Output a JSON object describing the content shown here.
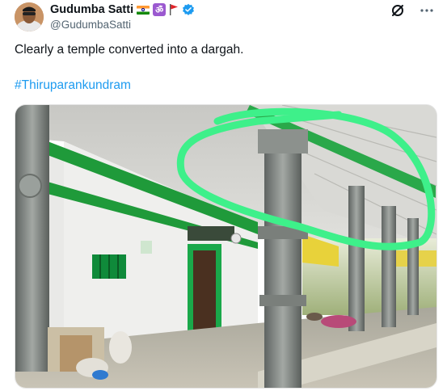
{
  "author": {
    "display_name": "Gudumba Satti",
    "handle": "@GudumbaSatti",
    "badges": [
      "india-flag-emoji",
      "om-symbol-emoji",
      "red-pennant-flag-emoji",
      "verified-badge"
    ]
  },
  "header_actions": {
    "grok_icon": "grok-icon",
    "more_icon": "more-options-icon"
  },
  "tweet": {
    "text": "Clearly a temple converted into a dargah.",
    "hashtag": "#Thiruparankundram"
  },
  "media": {
    "type": "photo",
    "subject": "pillared hall with white walls, green trim and carved grey stone pillars",
    "annotation_color": "#3ef08a"
  },
  "colors": {
    "verified": "#1d9bf0",
    "hashtag": "#1d9bf0",
    "secondary_text": "#536471",
    "wall_trim_green": "#1f9a3a"
  }
}
